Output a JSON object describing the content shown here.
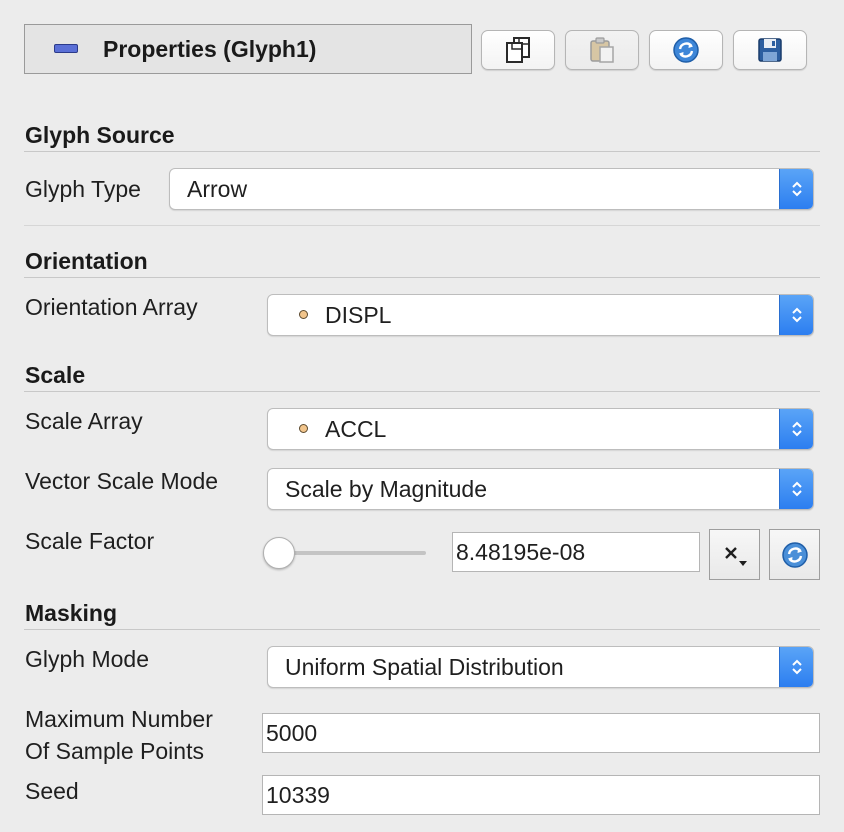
{
  "header": {
    "title": "Properties (Glyph1)",
    "icon": "panel-dash-icon",
    "buttons": [
      {
        "name": "copy",
        "icon": "copy-icon",
        "enabled": true
      },
      {
        "name": "paste",
        "icon": "paste-icon",
        "enabled": false
      },
      {
        "name": "reload",
        "icon": "reload-icon",
        "enabled": true
      },
      {
        "name": "save",
        "icon": "save-icon",
        "enabled": true
      }
    ]
  },
  "glyph_source": {
    "title": "Glyph Source",
    "glyph_type_label": "Glyph Type",
    "glyph_type_value": "Arrow"
  },
  "orientation": {
    "title": "Orientation",
    "orientation_array_label": "Orientation Array",
    "orientation_array_value": "DISPL"
  },
  "scale": {
    "title": "Scale",
    "scale_array_label": "Scale Array",
    "scale_array_value": "ACCL",
    "vector_scale_mode_label": "Vector Scale Mode",
    "vector_scale_mode_value": "Scale by Magnitude",
    "scale_factor_label": "Scale Factor",
    "scale_factor_value": "8.48195e-08",
    "scale_factor_slider_fraction": 0.0
  },
  "masking": {
    "title": "Masking",
    "glyph_mode_label": "Glyph Mode",
    "glyph_mode_value": "Uniform Spatial Distribution",
    "max_points_label_line1": "Maximum Number",
    "max_points_label_line2": "Of Sample Points",
    "max_points_value": "5000",
    "seed_label": "Seed",
    "seed_value": "10339"
  },
  "colors": {
    "accent": "#2c7ef0",
    "background": "#ececec",
    "array_dot": "#f2c58c"
  }
}
